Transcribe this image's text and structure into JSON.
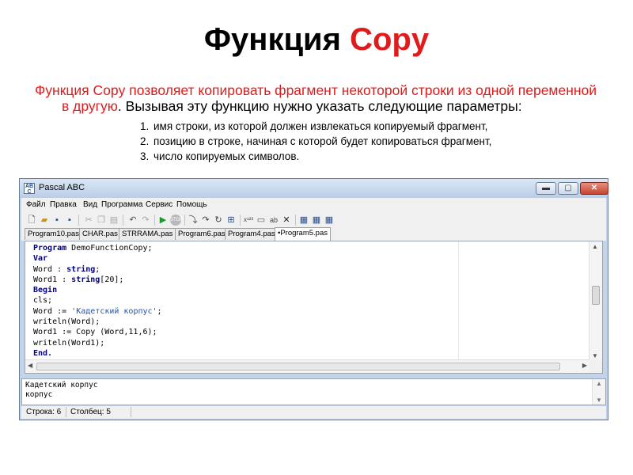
{
  "slide": {
    "title_plain": "Функция ",
    "title_accent": "Copy",
    "intro_red": "Функция Copy позволяет копировать фрагмент некоторой строки из одной переменной в другую",
    "intro_black": ". Вызывая эту функцию нужно указать следующие параметры:",
    "params": [
      "имя строки, из которой должен извлекаться копируемый фрагмент,",
      "позицию в строке, начиная с которой будет копироваться фрагмент,",
      "число копируемых символов."
    ]
  },
  "window": {
    "title": "Pascal ABC",
    "app_icon": "AB\nC",
    "controls": {
      "minimize": "▬",
      "maximize": "▢",
      "close": "✕"
    }
  },
  "menu": [
    "Файл",
    "Правка",
    "Вид",
    "Программа",
    "Сервис",
    "Помощь"
  ],
  "toolbar_icons": [
    "new-file-icon",
    "open-folder-icon",
    "save-icon",
    "save-all-icon",
    "cut-icon",
    "copy-icon",
    "paste-icon",
    "undo-icon",
    "redo-icon",
    "run-icon",
    "stop-icon",
    "step-into-icon",
    "step-over-icon",
    "step-out-icon",
    "breakpoint-icon",
    "eval-icon",
    "watch-icon",
    "locals-icon",
    "close-icon",
    "compile-icon",
    "compile-all-icon",
    "options-icon"
  ],
  "tabs": [
    "Program10.pas",
    "CHAR.pas",
    "STRRAMA.pas",
    "Program6.pas",
    "Program4.pas",
    "•Program5.pas"
  ],
  "active_tab": "•Program5.pas",
  "code": [
    [
      {
        "t": "Program",
        "k": "kw"
      },
      {
        "t": " DemoFunctionCopy;",
        "k": ""
      }
    ],
    [
      {
        "t": "Var",
        "k": "kw"
      }
    ],
    [
      {
        "t": "Word : ",
        "k": ""
      },
      {
        "t": "string",
        "k": "kw"
      },
      {
        "t": ";",
        "k": ""
      }
    ],
    [
      {
        "t": "Word1 : ",
        "k": ""
      },
      {
        "t": "string",
        "k": "kw"
      },
      {
        "t": "[20];",
        "k": ""
      }
    ],
    [
      {
        "t": "Begin",
        "k": "kw"
      }
    ],
    [
      {
        "t": "cls;",
        "k": ""
      }
    ],
    [
      {
        "t": "Word := ",
        "k": ""
      },
      {
        "t": "'Кадетский корпус'",
        "k": "str"
      },
      {
        "t": ";",
        "k": ""
      }
    ],
    [
      {
        "t": "writeln(Word);",
        "k": ""
      }
    ],
    [
      {
        "t": "Word1 := Copy (Word,11,6);",
        "k": ""
      }
    ],
    [
      {
        "t": "writeln(Word1);",
        "k": ""
      }
    ],
    [
      {
        "t": "End.",
        "k": "kw"
      }
    ]
  ],
  "output": {
    "lines": [
      "Кадетский корпус",
      "корпус"
    ]
  },
  "status": {
    "row": "Строка: 6",
    "col": "Столбец: 5"
  }
}
